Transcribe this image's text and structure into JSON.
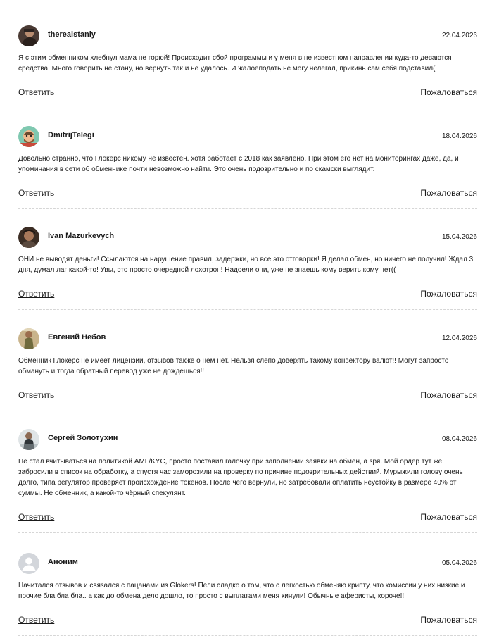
{
  "reviews": [
    {
      "username": "therealstanly",
      "date": "22.04.2026",
      "text": "Я с этим обменником хлебнул мама не горюй! Происходит сбой программы и у меня в не известном направлении куда-то деваются средства. Много говорить не стану, но вернуть так и не удалось. И жалоеподать не могу нелегал, прикинь сам себя подставил(",
      "reply_label": "Ответить",
      "report_label": "Пожаловаться",
      "avatar_icon": "user-photo-avatar"
    },
    {
      "username": "DmitrijTelegi",
      "date": "18.04.2026",
      "text": "Довольно странно, что Глокерс никому не известен. хотя работает с 2018 как заявлено. При этом его нет на мониторингах даже, да, и упоминания в сети об обменнике почти невозможно найти. Это очень подозрительно и по скамски выглядит.",
      "reply_label": "Ответить",
      "report_label": "Пожаловаться",
      "avatar_icon": "cartoon-avatar"
    },
    {
      "username": "Ivan Mazurkevych",
      "date": "15.04.2026",
      "text": "ОНИ не выводят деньги! Ссылаются на нарушение правил, задержки, но все это отговорки! Я делал обмен, но ничего не получил! Ждал 3 дня, думал лаг какой-то! Увы, это просто очередной лохотрон! Надоели они, уже не знаешь кому верить кому нет((",
      "reply_label": "Ответить",
      "report_label": "Пожаловаться",
      "avatar_icon": "user-photo-avatar"
    },
    {
      "username": "Евгений Небов",
      "date": "12.04.2026",
      "text": "Обменник Глокерс не имеет лицензии, отзывов также о нем нет. Нельзя слепо доверять такому конвектору валют!! Могут запросто обмануть и тогда обратный перевод уже не дождешься!!",
      "reply_label": "Ответить",
      "report_label": "Пожаловаться",
      "avatar_icon": "user-photo-avatar"
    },
    {
      "username": "Сергей Золотухин",
      "date": "08.04.2026",
      "text": "Не стал вчитываться на политикой AML/KYC, просто поставил галочку при заполнении заявки на обмен, а зря. Мой ордер тут же забросили в список на обработку, а спустя час заморозили на проверку по причине подозрительных действий. Мурыжили голову очень долго, типа регулятор проверяет происхождение токенов. После чего вернули, но затребовали оплатить неустойку в размере 40% от суммы. Не обменник, а какой-то чёрный спекулянт.",
      "reply_label": "Ответить",
      "report_label": "Пожаловаться",
      "avatar_icon": "user-photo-avatar"
    },
    {
      "username": "Аноним",
      "date": "05.04.2026",
      "text": "Начитался отзывов и связался с пацанами из Glokers! Пели сладко о том, что с легкостью обменяю крипту, что комиссии у них низкие и прочие бла бла бла.. а как до обмена дело дошло, то просто с выплатами меня кинули! Обычные аферисты, короче!!!",
      "reply_label": "Ответить",
      "report_label": "Пожаловаться",
      "avatar_icon": "default-user-avatar"
    }
  ]
}
